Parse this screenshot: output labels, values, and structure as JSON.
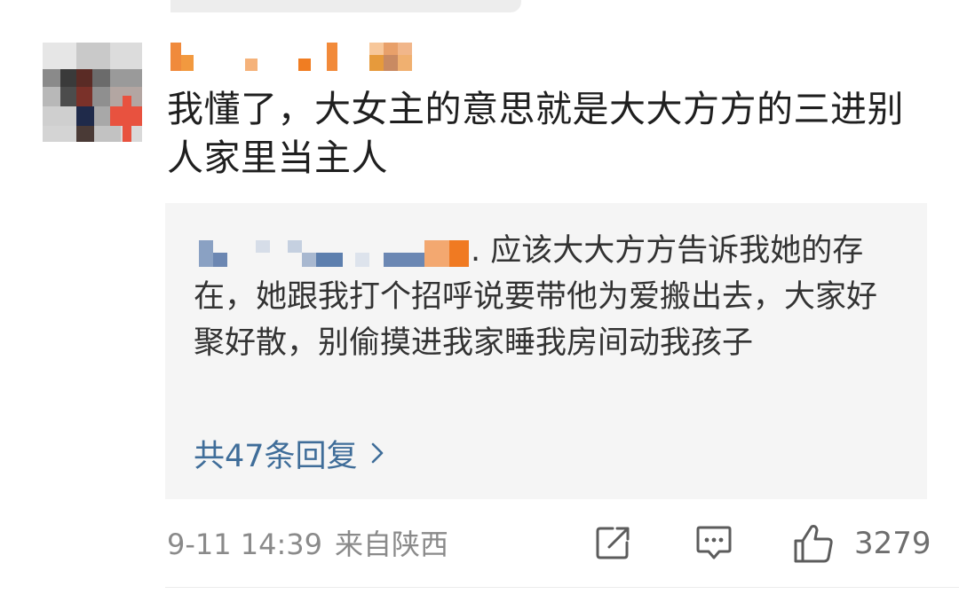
{
  "comment": {
    "text": "我懂了，大女主的意思就是大大方方的三进别人家里当主人"
  },
  "reply": {
    "text": ". 应该大大方方告诉我她的存在，她跟我打个招呼说要带他为爱搬出去，大家好聚好散，别偷摸进我家睡我房间动我孩子",
    "emoji": "sweat-smile-icon",
    "count_label": "共47条回复"
  },
  "footer": {
    "date": "9-11 14:39",
    "location": "来自陕西",
    "like_count": "3279"
  },
  "colors": {
    "link": "#3f6d99",
    "meta": "#8a8a8a",
    "reply_bg": "#f5f5f5",
    "text": "#1f1f1f"
  }
}
